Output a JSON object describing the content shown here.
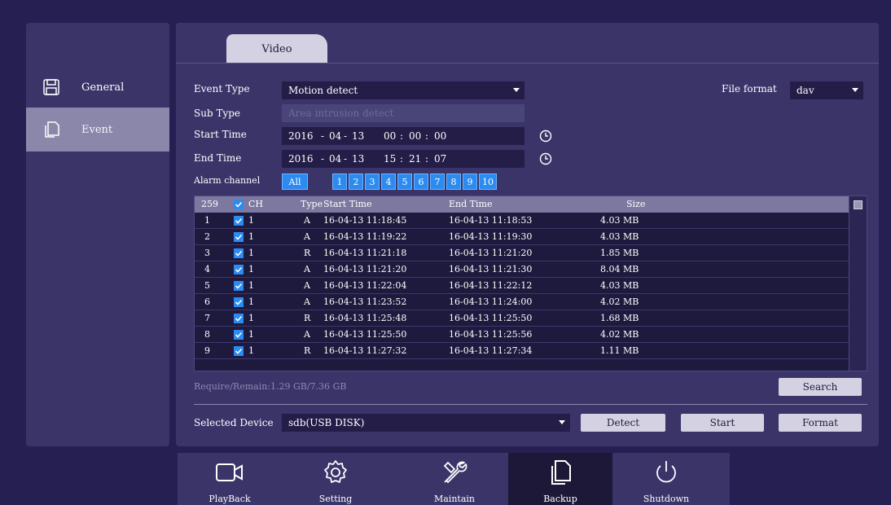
{
  "sidebar": {
    "items": [
      {
        "label": "General",
        "icon": "save-icon",
        "active": false
      },
      {
        "label": "Event",
        "icon": "copy-icon",
        "active": true
      }
    ]
  },
  "tabs": [
    {
      "label": "Video",
      "active": true
    }
  ],
  "form": {
    "event_type_label": "Event Type",
    "event_type_value": "Motion detect",
    "sub_type_label": "Sub Type",
    "sub_type_value": "Area intrusion detect",
    "start_time_label": "Start Time",
    "start_time": {
      "year": "2016",
      "month": "04",
      "day": "13",
      "hour": "00",
      "minute": "00",
      "second": "00"
    },
    "end_time_label": "End Time",
    "end_time": {
      "year": "2016",
      "month": "04",
      "day": "13",
      "hour": "15",
      "minute": "21",
      "second": "07"
    },
    "file_format_label": "File format",
    "file_format_value": "dav",
    "alarm_channel_label": "Alarm channel",
    "alarm_channels": [
      "All",
      "1",
      "2",
      "3",
      "4",
      "5",
      "6",
      "7",
      "8",
      "9",
      "10"
    ]
  },
  "table": {
    "count": "259",
    "headers": {
      "ch": "CH",
      "type": "Type",
      "start": "Start Time",
      "end": "End Time",
      "size": "Size"
    },
    "rows": [
      {
        "no": "1",
        "ch": "1",
        "type": "A",
        "start": "16-04-13 11:18:45",
        "end": "16-04-13 11:18:53",
        "size": "4.03 MB"
      },
      {
        "no": "2",
        "ch": "1",
        "type": "A",
        "start": "16-04-13 11:19:22",
        "end": "16-04-13 11:19:30",
        "size": "4.03 MB"
      },
      {
        "no": "3",
        "ch": "1",
        "type": "R",
        "start": "16-04-13 11:21:18",
        "end": "16-04-13 11:21:20",
        "size": "1.85 MB"
      },
      {
        "no": "4",
        "ch": "1",
        "type": "A",
        "start": "16-04-13 11:21:20",
        "end": "16-04-13 11:21:30",
        "size": "8.04 MB"
      },
      {
        "no": "5",
        "ch": "1",
        "type": "A",
        "start": "16-04-13 11:22:04",
        "end": "16-04-13 11:22:12",
        "size": "4.03 MB"
      },
      {
        "no": "6",
        "ch": "1",
        "type": "A",
        "start": "16-04-13 11:23:52",
        "end": "16-04-13 11:24:00",
        "size": "4.02 MB"
      },
      {
        "no": "7",
        "ch": "1",
        "type": "R",
        "start": "16-04-13 11:25:48",
        "end": "16-04-13 11:25:50",
        "size": "1.68 MB"
      },
      {
        "no": "8",
        "ch": "1",
        "type": "A",
        "start": "16-04-13 11:25:50",
        "end": "16-04-13 11:25:56",
        "size": "4.02 MB"
      },
      {
        "no": "9",
        "ch": "1",
        "type": "R",
        "start": "16-04-13 11:27:32",
        "end": "16-04-13 11:27:34",
        "size": "1.11 MB"
      }
    ]
  },
  "require_remain": "Require/Remain:1.29 GB/7.36 GB",
  "buttons": {
    "search": "Search",
    "detect": "Detect",
    "start": "Start",
    "format": "Format"
  },
  "device": {
    "label": "Selected Device",
    "value": "sdb(USB DISK)"
  },
  "dock": {
    "items": [
      {
        "label": "PlayBack",
        "icon": "camera-icon",
        "active": false
      },
      {
        "label": "Setting",
        "icon": "gear-icon",
        "active": false
      },
      {
        "label": "Maintain",
        "icon": "tools-icon",
        "active": false
      },
      {
        "label": "Backup",
        "icon": "backup-icon",
        "active": true
      },
      {
        "label": "Shutdown",
        "icon": "power-icon",
        "active": false
      }
    ]
  }
}
